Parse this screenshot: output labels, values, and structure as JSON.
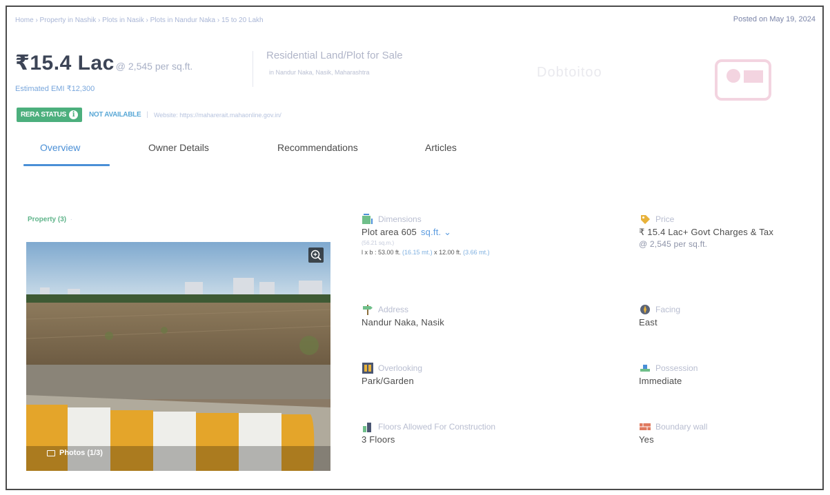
{
  "breadcrumb": "Home › Property in Nashik › Plots in Nasik › Plots in Nandur Naka › 15 to 20 Lakh",
  "posted": "Posted on May 19, 2024",
  "price": {
    "amount": "₹15.4 Lac",
    "rate": "@ 2,545 per sq.ft.",
    "emi": "Estimated EMI ₹12,300"
  },
  "property": {
    "title": "Residential Land/Plot for Sale",
    "location": "in Nandur Naka, Nasik, Maharashtra"
  },
  "rera": {
    "badge": "RERA STATUS",
    "info_icon": "info-icon",
    "status": "NOT AVAILABLE",
    "separator": "|",
    "website": "Website: https://maharerait.mahaonline.gov.in/"
  },
  "tabs": [
    {
      "label": "Overview",
      "active": true
    },
    {
      "label": "Owner Details",
      "active": false
    },
    {
      "label": "Recommendations",
      "active": false
    },
    {
      "label": "Articles",
      "active": false
    }
  ],
  "gallery": {
    "label": "Property (3)",
    "photos_label": "Photos (1/3)",
    "zoom_icon": "zoom-in-icon"
  },
  "details": {
    "dimensions": {
      "label": "Dimensions",
      "value": "Plot area 605",
      "unit": "sq.ft.",
      "sub": "(56.21 sq.m.)",
      "dims_prefix": "l x b : 53.00 ft.",
      "dims_m1": "(16.15 mt.)",
      "dims_mid": "x 12.00 ft.",
      "dims_m2": "(3.66 mt.)"
    },
    "price": {
      "label": "Price",
      "value": "₹ 15.4 Lac+ Govt Charges & Tax",
      "sub": "@ 2,545 per sq.ft."
    },
    "address": {
      "label": "Address",
      "value": "Nandur Naka, Nasik"
    },
    "facing": {
      "label": "Facing",
      "value": "East"
    },
    "overlooking": {
      "label": "Overlooking",
      "value": "Park/Garden"
    },
    "possession": {
      "label": "Possession",
      "value": "Immediate"
    },
    "floors": {
      "label": "Floors Allowed For Construction",
      "value": "3 Floors"
    },
    "boundary": {
      "label": "Boundary wall",
      "value": "Yes"
    }
  },
  "colors": {
    "accent": "#4a8fd6",
    "rera_green": "#4caf7d",
    "price_text": "#3c4456"
  }
}
